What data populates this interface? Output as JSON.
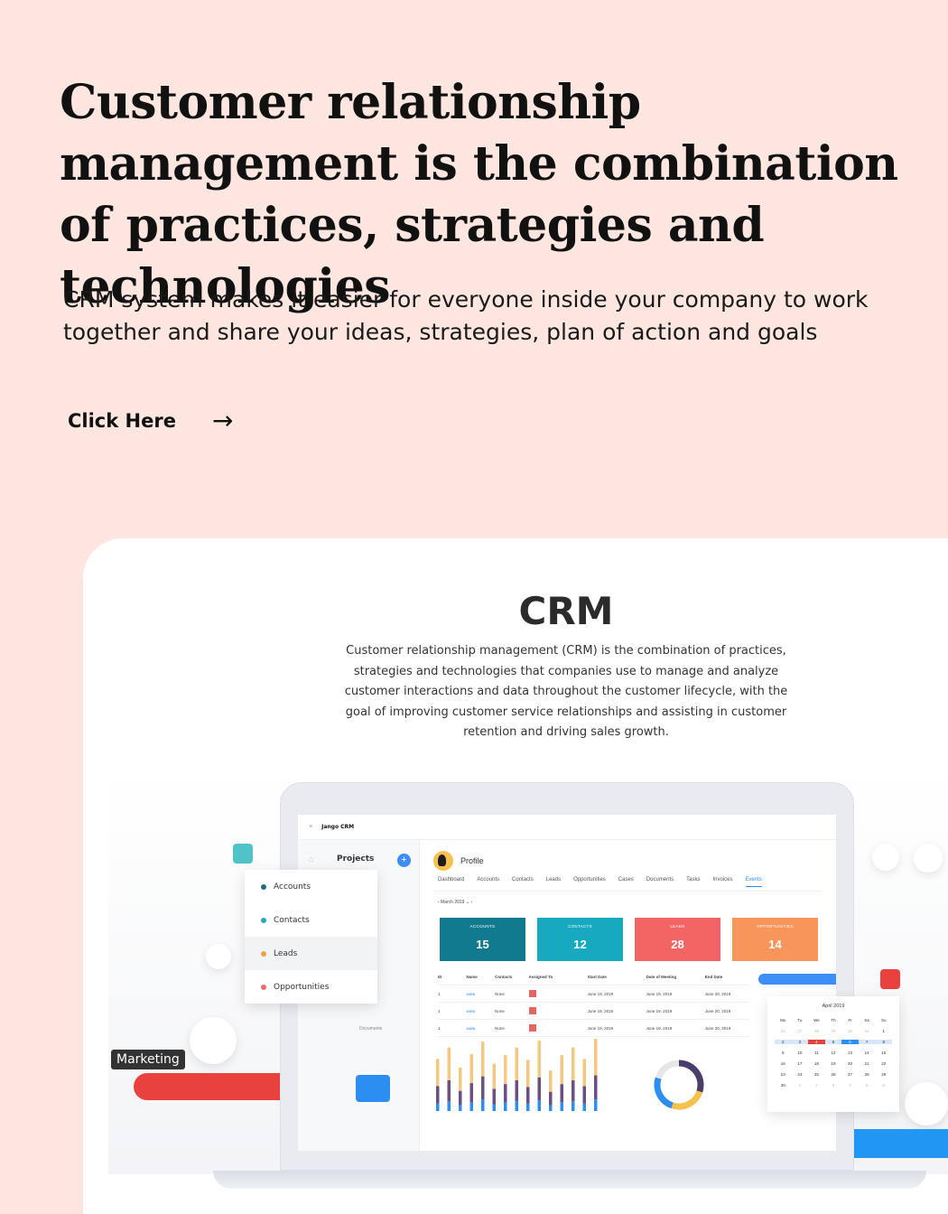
{
  "hero": {
    "title": "Customer relationship management is the combination of practices, strategies and technologies",
    "subtitle": "CRM system makes it easier for everyone inside your company to work together and share your ideas, strategies, plan of action and goals",
    "cta_label": "Click Here",
    "cta_arrow": "→"
  },
  "crm": {
    "title": "CRM",
    "description": "Customer relationship management (CRM) is the combination of practices, strategies and technologies that companies use to manage and analyze customer interactions and data throughout the customer lifecycle, with the goal of improving customer service relationships and assisting in customer retention and driving sales growth."
  },
  "app": {
    "logo": "Jango CRM",
    "sidebar_title": "Projects",
    "plus": "+",
    "documents_label": "Documents",
    "profile": "Profile",
    "tabs": [
      "Dashboard",
      "Accounts",
      "Contacts",
      "Leads",
      "Opportunities",
      "Cases",
      "Documents",
      "Tasks",
      "Invoices",
      "Events"
    ],
    "active_tab": "Events",
    "month": "‹  March 2019  ⌄  ›",
    "stats": [
      {
        "name": "ACCOUNTS",
        "value": "15",
        "color": "#127a8e"
      },
      {
        "name": "CONTACTS",
        "value": "12",
        "color": "#16a9bf"
      },
      {
        "name": "LEADS",
        "value": "28",
        "color": "#f36565"
      },
      {
        "name": "OPPORTUNITIES",
        "value": "14",
        "color": "#f7955a"
      }
    ],
    "table_headers": [
      "ID",
      "Name",
      "Contacts",
      "Assigned To",
      "Start Date",
      "Date of Meeting",
      "End Date"
    ],
    "table_rows": [
      [
        "1",
        "www",
        "None",
        "",
        "June 19, 2019",
        "June 19, 2019",
        "June 20, 2019"
      ],
      [
        "1",
        "www",
        "None",
        "",
        "June 19, 2019",
        "June 19, 2019",
        "June 20, 2019"
      ],
      [
        "1",
        "www",
        "None",
        "",
        "June 19, 2019",
        "June 19, 2019",
        "June 20, 2019"
      ]
    ]
  },
  "popup": {
    "items": [
      {
        "label": "Accounts",
        "color": "#1d6c7e"
      },
      {
        "label": "Contacts",
        "color": "#27a9c2"
      },
      {
        "label": "Leads",
        "color": "#f0a04a"
      },
      {
        "label": "Opportunities",
        "color": "#f16b6b"
      }
    ]
  },
  "marketing_label": "Marketing",
  "calendar": {
    "title": "April 2019",
    "days": [
      "Mo",
      "Tu",
      "We",
      "Th",
      "Fr",
      "Sa",
      "Su"
    ],
    "dates": [
      "26",
      "27",
      "28",
      "29",
      "30",
      "31",
      "1",
      "2",
      "3",
      "4",
      "5",
      "6",
      "7",
      "8",
      "9",
      "10",
      "11",
      "12",
      "13",
      "14",
      "15",
      "16",
      "17",
      "18",
      "19",
      "20",
      "21",
      "22",
      "23",
      "24",
      "25",
      "26",
      "27",
      "28",
      "29",
      "30",
      "1",
      "2",
      "3",
      "4",
      "5",
      "6"
    ]
  },
  "chart_data": [
    {
      "type": "bar",
      "stacked": true,
      "categories": [
        "",
        "",
        "",
        "",
        "",
        "",
        "",
        "",
        "",
        "",
        "",
        "",
        "",
        "",
        ""
      ],
      "series": [
        {
          "values": [
            8,
            10,
            6,
            9,
            12,
            7,
            9,
            10,
            8,
            11,
            6,
            9,
            10,
            8,
            12
          ],
          "color": "#2c8ef0"
        },
        {
          "values": [
            18,
            22,
            15,
            20,
            24,
            16,
            19,
            22,
            17,
            24,
            14,
            19,
            22,
            18,
            25
          ],
          "color": "#6b4f83"
        },
        {
          "values": [
            28,
            34,
            24,
            30,
            36,
            26,
            30,
            34,
            28,
            38,
            22,
            30,
            34,
            28,
            38
          ],
          "color": "#f6c780"
        }
      ]
    },
    {
      "type": "pie",
      "donut": true,
      "values": [
        30,
        25,
        25,
        20
      ],
      "colors": [
        "#4a3d6b",
        "#f6c14f",
        "#2c8ef0",
        "#e6e6e6"
      ]
    }
  ],
  "colors": {
    "background": "#fde6df",
    "accent_blue": "#2196f3",
    "accent_red": "#e9413d"
  }
}
